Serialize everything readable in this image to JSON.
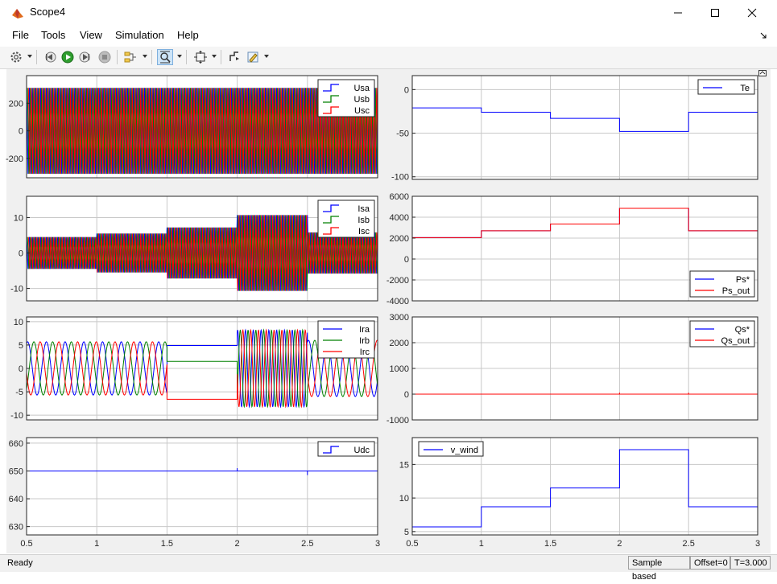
{
  "window": {
    "title": "Scope4",
    "colors": {
      "accent": "#0000ff"
    }
  },
  "menu": [
    "File",
    "Tools",
    "View",
    "Simulation",
    "Help"
  ],
  "toolbar": {
    "icons": [
      "gear-icon",
      "step-back-icon",
      "run-icon",
      "step-forward-icon",
      "stop-icon",
      "signal-selector-icon",
      "zoom-icon",
      "autoscale-icon",
      "trigger-icon",
      "highlight-icon"
    ]
  },
  "status": {
    "ready": "Ready",
    "sample": "Sample based",
    "offset": "Offset=0",
    "time": "T=3.000"
  },
  "chart_data": [
    {
      "type": "line",
      "position": "left-1",
      "xlim": [
        0.5,
        3
      ],
      "ylim": [
        -340,
        400
      ],
      "yticks": [
        -200,
        0,
        200
      ],
      "ytick_labels": [
        "-200",
        "0",
        "200"
      ],
      "grid": true,
      "legend_placement": "top-right",
      "series": [
        {
          "name": "Usa",
          "color": "#0000ff",
          "kind": "oscillation",
          "envelope": [
            [
              0.5,
              311
            ],
            [
              3,
              311
            ]
          ],
          "freq": 50
        },
        {
          "name": "Usb",
          "color": "#008000",
          "kind": "oscillation",
          "envelope": [
            [
              0.5,
              311
            ],
            [
              3,
              311
            ]
          ],
          "freq": 50
        },
        {
          "name": "Usc",
          "color": "#ff0000",
          "kind": "oscillation",
          "envelope": [
            [
              0.5,
              311
            ],
            [
              3,
              311
            ]
          ],
          "freq": 50
        }
      ]
    },
    {
      "type": "line",
      "position": "left-2",
      "xlim": [
        0.5,
        3
      ],
      "ylim": [
        -13.5,
        16
      ],
      "yticks": [
        -10,
        0,
        10
      ],
      "ytick_labels": [
        "-10",
        "0",
        "10"
      ],
      "grid": true,
      "legend_placement": "top-right",
      "series": [
        {
          "name": "Isa",
          "color": "#0000ff",
          "kind": "oscillation",
          "envelope": [
            [
              0.5,
              4.5
            ],
            [
              1,
              4.5
            ],
            [
              1,
              5.5
            ],
            [
              1.5,
              5.5
            ],
            [
              1.5,
              7.2
            ],
            [
              2,
              7.2
            ],
            [
              2,
              10.7
            ],
            [
              2.5,
              10.7
            ],
            [
              2.5,
              5.8
            ],
            [
              3,
              5.8
            ]
          ],
          "freq": 50
        },
        {
          "name": "Isb",
          "color": "#008000",
          "kind": "oscillation",
          "envelope": [
            [
              0.5,
              4.5
            ],
            [
              1,
              4.5
            ],
            [
              1,
              5.5
            ],
            [
              1.5,
              5.5
            ],
            [
              1.5,
              7.2
            ],
            [
              2,
              7.2
            ],
            [
              2,
              10.7
            ],
            [
              2.5,
              10.7
            ],
            [
              2.5,
              5.8
            ],
            [
              3,
              5.8
            ]
          ],
          "freq": 50
        },
        {
          "name": "Isc",
          "color": "#ff0000",
          "kind": "oscillation",
          "envelope": [
            [
              0.5,
              4.5
            ],
            [
              1,
              4.5
            ],
            [
              1,
              5.5
            ],
            [
              1.5,
              5.5
            ],
            [
              1.5,
              7.2
            ],
            [
              2,
              7.2
            ],
            [
              2,
              10.7
            ],
            [
              2.5,
              10.7
            ],
            [
              2.5,
              5.8
            ],
            [
              3,
              5.8
            ]
          ],
          "freq": 50
        }
      ]
    },
    {
      "type": "line",
      "position": "left-3",
      "xlim": [
        0.5,
        3
      ],
      "ylim": [
        -11,
        11
      ],
      "yticks": [
        -10,
        -5,
        0,
        5,
        10
      ],
      "ytick_labels": [
        "-10",
        "-5",
        "0",
        "5",
        "10"
      ],
      "grid": true,
      "legend_placement": "top-right",
      "series": [
        {
          "name": "Ira",
          "color": "#0000ff",
          "kind": "rotor",
          "phase": 0
        },
        {
          "name": "Irb",
          "color": "#008000",
          "kind": "rotor",
          "phase": -2.0944
        },
        {
          "name": "Irc",
          "color": "#ff0000",
          "kind": "rotor",
          "phase": 2.0944
        }
      ],
      "rotor_segments": [
        {
          "x0": 0.5,
          "x1": 1.5,
          "amp": 5.7,
          "freq": 7.5
        },
        {
          "x0": 1.5,
          "x1": 2.0,
          "amp": 0,
          "dc": [
            4.9,
            1.5,
            -6.6
          ]
        },
        {
          "x0": 2.0,
          "x1": 2.5,
          "amp": 8.2,
          "freq": 18
        },
        {
          "x0": 2.5,
          "x1": 3.0,
          "amp": 6.0,
          "freq": 7.5
        }
      ]
    },
    {
      "type": "line",
      "position": "left-4",
      "xlim": [
        0.5,
        3
      ],
      "ylim": [
        627,
        662
      ],
      "yticks": [
        630,
        640,
        650,
        660
      ],
      "ytick_labels": [
        "630",
        "640",
        "650",
        "660"
      ],
      "xticks": [
        0.5,
        1,
        1.5,
        2,
        2.5,
        3
      ],
      "xtick_labels": [
        "0.5",
        "1",
        "1.5",
        "2",
        "2.5",
        "3"
      ],
      "grid": true,
      "legend_placement": "top-right",
      "series": [
        {
          "name": "Udc",
          "color": "#0000ff",
          "kind": "steps",
          "points": [
            [
              0.5,
              650
            ],
            [
              3,
              650
            ]
          ],
          "spikes": [
            [
              2,
              651
            ],
            [
              2.5,
              648.5
            ]
          ]
        }
      ]
    },
    {
      "type": "line",
      "position": "right-1",
      "xlim": [
        0.5,
        3
      ],
      "ylim": [
        -103,
        16
      ],
      "yticks": [
        -100,
        -50,
        0
      ],
      "ytick_labels": [
        "-100",
        "-50",
        "0"
      ],
      "grid": true,
      "legend_placement": "top-right",
      "series": [
        {
          "name": "Te",
          "color": "#0000ff",
          "kind": "steps",
          "points": [
            [
              0.5,
              -21
            ],
            [
              1,
              -21
            ],
            [
              1,
              -26
            ],
            [
              1.5,
              -26
            ],
            [
              1.5,
              -33
            ],
            [
              2,
              -33
            ],
            [
              2,
              -48
            ],
            [
              2.5,
              -48
            ],
            [
              2.5,
              -26
            ],
            [
              3,
              -26
            ]
          ]
        }
      ]
    },
    {
      "type": "line",
      "position": "right-2",
      "xlim": [
        0.5,
        3
      ],
      "ylim": [
        -4000,
        6000
      ],
      "yticks": [
        -4000,
        -2000,
        0,
        2000,
        4000,
        6000
      ],
      "ytick_labels": [
        "-4000",
        "-2000",
        "0",
        "2000",
        "4000",
        "6000"
      ],
      "grid": true,
      "legend_placement": "bottom-right",
      "series": [
        {
          "name": "Ps*",
          "color": "#0000ff",
          "kind": "steps",
          "points": [
            [
              0.5,
              2050
            ],
            [
              1,
              2050
            ],
            [
              1,
              2700
            ],
            [
              1.5,
              2700
            ],
            [
              1.5,
              3350
            ],
            [
              2,
              3350
            ],
            [
              2,
              4850
            ],
            [
              2.5,
              4850
            ],
            [
              2.5,
              2700
            ],
            [
              3,
              2700
            ]
          ]
        },
        {
          "name": "Ps_out",
          "color": "#ff0000",
          "kind": "steps",
          "points": [
            [
              0.5,
              2050
            ],
            [
              1,
              2050
            ],
            [
              1,
              2700
            ],
            [
              1.5,
              2700
            ],
            [
              1.5,
              3350
            ],
            [
              2,
              3350
            ],
            [
              2,
              4850
            ],
            [
              2.5,
              4850
            ],
            [
              2.5,
              2700
            ],
            [
              3,
              2700
            ]
          ]
        }
      ]
    },
    {
      "type": "line",
      "position": "right-3",
      "xlim": [
        0.5,
        3
      ],
      "ylim": [
        -1000,
        3000
      ],
      "yticks": [
        -1000,
        0,
        1000,
        2000,
        3000
      ],
      "ytick_labels": [
        "-1000",
        "0",
        "1000",
        "2000",
        "3000"
      ],
      "grid": true,
      "legend_placement": "top-right",
      "series": [
        {
          "name": "Qs*",
          "color": "#0000ff",
          "kind": "steps",
          "points": [
            [
              0.5,
              0
            ],
            [
              3,
              0
            ]
          ]
        },
        {
          "name": "Qs_out",
          "color": "#ff0000",
          "kind": "steps",
          "points": [
            [
              0.5,
              0
            ],
            [
              3,
              0
            ]
          ],
          "spikes": [
            [
              2,
              60
            ],
            [
              2.5,
              60
            ]
          ]
        }
      ]
    },
    {
      "type": "line",
      "position": "right-4",
      "xlim": [
        0.5,
        3
      ],
      "ylim": [
        4.5,
        19
      ],
      "yticks": [
        5,
        10,
        15
      ],
      "ytick_labels": [
        "5",
        "10",
        "15"
      ],
      "xticks": [
        0.5,
        1,
        1.5,
        2,
        2.5,
        3
      ],
      "xtick_labels": [
        "0.5",
        "1",
        "1.5",
        "2",
        "2.5",
        "3"
      ],
      "grid": true,
      "legend_placement": "top-left",
      "series": [
        {
          "name": "v_wind",
          "color": "#0000ff",
          "kind": "steps",
          "points": [
            [
              0.5,
              5.7
            ],
            [
              1,
              5.7
            ],
            [
              1,
              8.7
            ],
            [
              1.5,
              8.7
            ],
            [
              1.5,
              11.5
            ],
            [
              2,
              11.5
            ],
            [
              2,
              17.2
            ],
            [
              2.5,
              17.2
            ],
            [
              2.5,
              8.7
            ],
            [
              3,
              8.7
            ]
          ]
        }
      ]
    }
  ]
}
